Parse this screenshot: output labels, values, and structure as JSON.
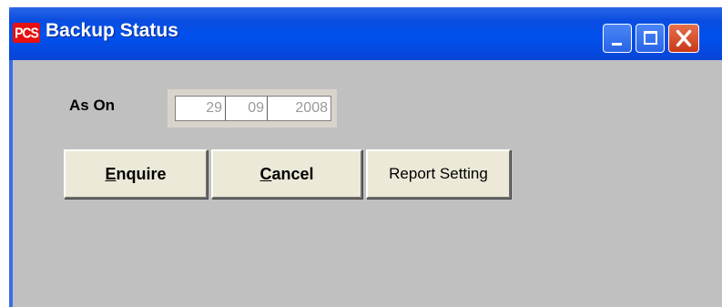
{
  "window": {
    "title": "Backup Status",
    "app_icon_text": "PCS",
    "controls": [
      "minimize-icon",
      "maximize-icon",
      "close-icon"
    ]
  },
  "form": {
    "as_on_label": "As On",
    "date": {
      "day": "29",
      "month": "09",
      "year": "2008"
    }
  },
  "buttons": {
    "enquire": {
      "mnemonic": "E",
      "rest": "nquire"
    },
    "cancel": {
      "mnemonic": "C",
      "rest": "ancel"
    },
    "report_setting": "Report Setting"
  },
  "colors": {
    "titlebar": "#0050ee",
    "client_bg": "#c0c0c0",
    "button_face": "#ece9d8",
    "close_button": "#d84a2a"
  }
}
